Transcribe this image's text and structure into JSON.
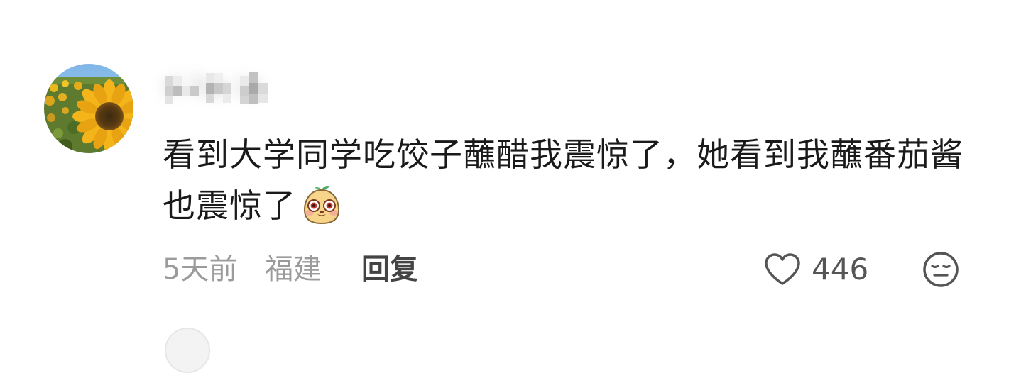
{
  "comment": {
    "username": "ri ha ie",
    "text": "看到大学同学吃饺子蘸醋我震惊了，她看到我蘸番茄酱也震惊了",
    "sticker_icon": "surprised-chick-sticker-icon",
    "time": "5天前",
    "location": "福建",
    "reply_label": "回复",
    "like_count": "446",
    "like_icon": "heart-outline-icon",
    "reaction_icon": "smiley-face-icon"
  },
  "colors": {
    "text": "#1a1a1a",
    "meta": "#9b9b9b",
    "reply": "#444444",
    "background": "#ffffff"
  }
}
